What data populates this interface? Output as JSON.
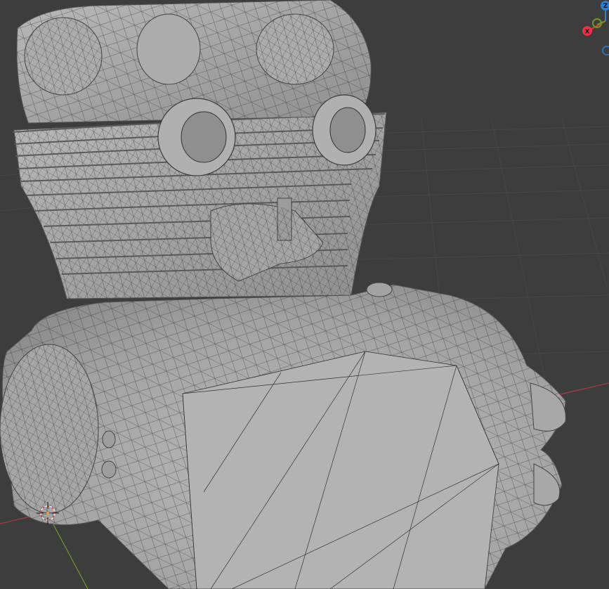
{
  "viewport": {
    "background": "#3d3d3d",
    "grid_color": "#464646",
    "axis_x_color": "#a83c46",
    "axis_y_color": "#6e8f2a",
    "mesh_fill": "#a9a9a9",
    "wire_color": "#2a2a2a"
  },
  "nav_gizmo": {
    "x_label": "X",
    "z_label": "Z",
    "x_color": "#e8314a",
    "y_color": "#6a9a24",
    "z_color": "#2d7fd6"
  },
  "scene": {
    "object_icon": "engine-mesh",
    "cursor_icon": "3d-cursor-icon"
  }
}
